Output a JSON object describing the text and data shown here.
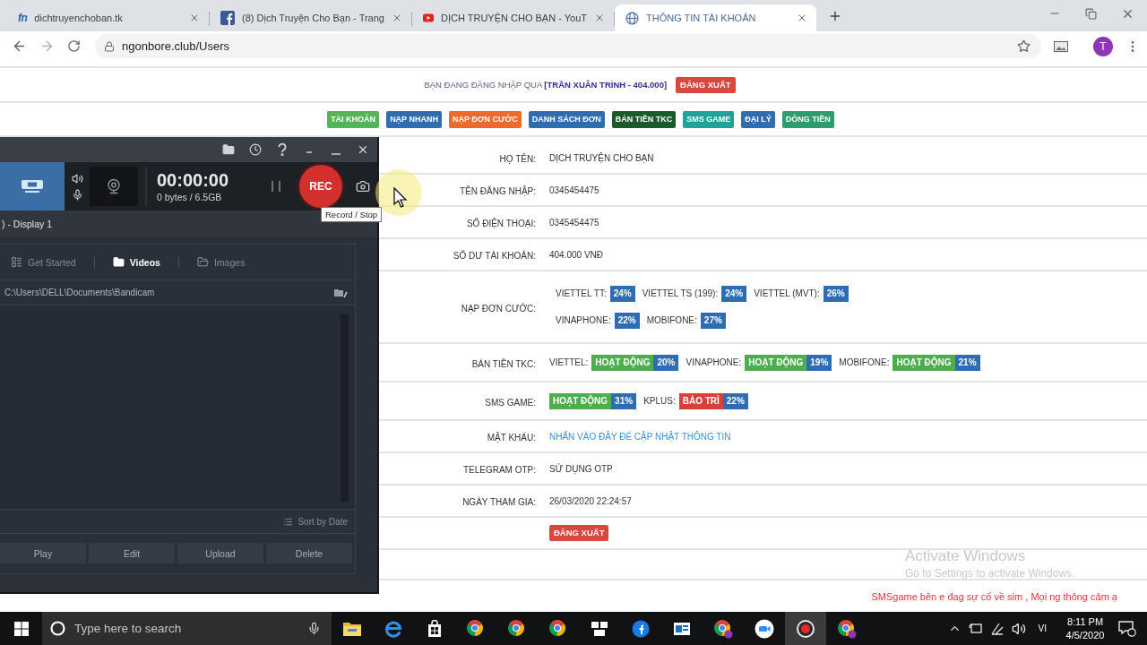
{
  "browser": {
    "tabs": [
      {
        "kind": "letters",
        "favicon_text": "fn",
        "title": "dichtruyenchoban.tk",
        "selected": false
      },
      {
        "kind": "social",
        "title": "(8) Dịch Truyện Cho Bạn - Trang",
        "selected": false
      },
      {
        "kind": "video",
        "title": "DỊCH TRUYỆN CHO BẠN - YouT",
        "selected": false
      },
      {
        "kind": "globe",
        "title": "THÔNG TIN TÀI KHOẢN",
        "selected": true
      }
    ],
    "address": "ngonbore.club/Users",
    "profile_initial": "T"
  },
  "page": {
    "login_line": "BẠN ĐANG ĐĂNG NHẬP QUA **[TRẦN XUÂN TRÌNH - 404.000]**",
    "logout_button": "ĐĂNG XUẤT",
    "nav": [
      {
        "label": "TÀI KHOẢN",
        "color": "#55b35a"
      },
      {
        "label": "NẠP NHANH",
        "color": "#2f6db0"
      },
      {
        "label": "NẠP ĐƠN CƯỚC",
        "color": "#ec6a2c"
      },
      {
        "label": "DANH SÁCH ĐƠN",
        "color": "#2f6db0"
      },
      {
        "label": "BÁN TIỀN TKC",
        "color": "#1c5a2b"
      },
      {
        "label": "SMS GAME",
        "color": "#1ea39b"
      },
      {
        "label": "ĐẠI LÝ",
        "color": "#2f6db0"
      },
      {
        "label": "DÒNG TIỀN",
        "color": "#2c9d6b"
      }
    ],
    "info_rows": [
      {
        "kind": "text",
        "label": "HỌ TÊN:",
        "value": "DỊCH TRUYỆN CHO BẠN"
      },
      {
        "kind": "text",
        "label": "TÊN ĐĂNG NHẬP:",
        "value": "0345454475"
      },
      {
        "kind": "text",
        "label": "SỐ ĐIỆN THOẠI:",
        "value": "0345454475"
      },
      {
        "kind": "text",
        "label": "SỐ DƯ TÀI KHOẢN:",
        "value": "404.000 VNĐ"
      },
      {
        "kind": "rates",
        "label": "NẠP ĐƠN CƯỚC:",
        "lines": [
          [
            {
              "name": "VIETTEL TT:",
              "rate": "24%"
            },
            {
              "name": "VIETTEL TS (199):",
              "rate": "24%"
            },
            {
              "name": "VIETTEL (MVT):",
              "rate": "26%"
            }
          ],
          [
            {
              "name": "VINAPHONE:",
              "rate": "22%"
            },
            {
              "name": "MOBIFONE:",
              "rate": "27%"
            }
          ]
        ]
      },
      {
        "kind": "status",
        "label": "BÁN TIỀN TKC:",
        "items": [
          {
            "name": "VIETTEL:",
            "status": "HOẠT ĐỘNG",
            "color": "#4cae4c",
            "rate": "20%"
          },
          {
            "name": "VINAPHONE:",
            "status": "HOẠT ĐỘNG",
            "color": "#4cae4c",
            "rate": "19%"
          },
          {
            "name": "MOBIFONE:",
            "status": "HOẠT ĐỘNG",
            "color": "#4cae4c",
            "rate": "21%"
          }
        ]
      },
      {
        "kind": "status",
        "label": "SMS GAME:",
        "items": [
          {
            "status": "HOẠT ĐỘNG",
            "color": "#4cae4c",
            "rate": "31%"
          },
          {
            "name": "KPLUS:",
            "status": "BẢO TRÌ",
            "color": "#d9403a",
            "rate": "22%"
          }
        ]
      },
      {
        "kind": "link",
        "label": "MẬT KHẨU:",
        "value": "NHẤN VÀO ĐÂY ĐỂ CẬP NHẬT THÔNG TIN"
      },
      {
        "kind": "text",
        "label": "TELEGRAM OTP:",
        "value": "SỬ DỤNG OTP"
      },
      {
        "kind": "text",
        "label": "NGÀY THAM GIA:",
        "value": "26/03/2020 22:24:57"
      },
      {
        "kind": "button",
        "value": "ĐĂNG XUẤT"
      }
    ],
    "notice": "SMSgame bên e đag sự cố về sim , Mọi ng thông cảm ạ"
  },
  "recorder": {
    "timer": "00:00:00",
    "file_size": "0 bytes / 6.5GB",
    "rec_label": "REC",
    "tooltip": "Record / Stop",
    "target": ") - Display 1",
    "tabs": [
      {
        "kind": "start",
        "label": "Get Started",
        "selected": false
      },
      {
        "kind": "videos",
        "label": "Videos",
        "selected": true
      },
      {
        "kind": "images",
        "label": "Images",
        "selected": false
      }
    ],
    "path": "C:\\Users\\DELL\\Documents\\Bandicam",
    "sort": "Sort by Date",
    "buttons": [
      "Play",
      "Edit",
      "Upload",
      "Delete"
    ]
  },
  "activation_notice": {
    "title": "Activate Windows",
    "subtitle": "Go to Settings to activate Windows."
  },
  "taskbar": {
    "search_placeholder": "Type here to search",
    "apps": [
      {
        "kind": "folder",
        "selected": false
      },
      {
        "kind": "e_logo",
        "selected": false
      },
      {
        "kind": "bag",
        "selected": false
      },
      {
        "kind": "ring_logo",
        "selected": false
      },
      {
        "kind": "ring_logo",
        "selected": false
      },
      {
        "kind": "ring_logo",
        "selected": false
      },
      {
        "kind": "tiles",
        "selected": false
      },
      {
        "kind": "round_f",
        "selected": false
      },
      {
        "kind": "window",
        "selected": false
      },
      {
        "kind": "ring_badge",
        "selected": false
      },
      {
        "kind": "bubble",
        "selected": false
      },
      {
        "kind": "record",
        "selected": true
      },
      {
        "kind": "ring_badge",
        "selected": false
      }
    ],
    "language": "VI",
    "time": "8:11 PM",
    "date": "4/5/2020"
  }
}
